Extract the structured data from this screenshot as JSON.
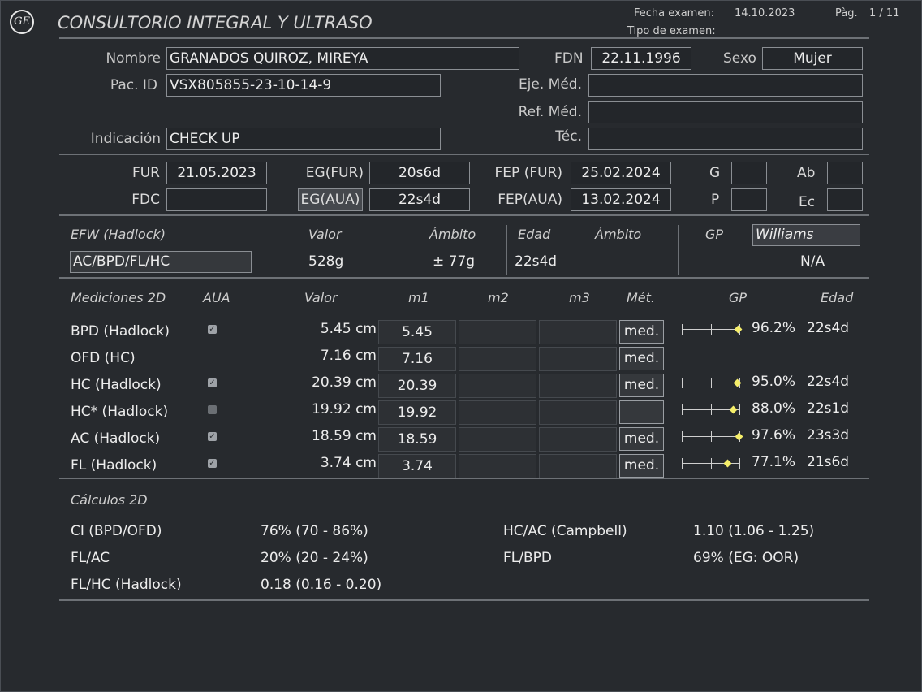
{
  "header": {
    "logo_text": "GE",
    "title": "CONSULTORIO INTEGRAL Y ULTRASO",
    "fecha_label": "Fecha examen:",
    "fecha_value": "14.10.2023",
    "tipo_label": "Tipo de examen:",
    "page_label": "Pàg.",
    "page_value": "1 / 11"
  },
  "patient": {
    "nombre_label": "Nombre",
    "nombre": "GRANADOS QUIROZ, MIREYA",
    "pacid_label": "Pac. ID",
    "pacid": "VSX805855-23-10-14-9",
    "indicacion_label": "Indicación",
    "indicacion": "CHECK UP",
    "fdn_label": "FDN",
    "fdn": "22.11.1996",
    "sexo_label": "Sexo",
    "sexo": "Mujer",
    "eje_label": "Eje. Méd.",
    "eje": "",
    "ref_label": "Ref. Méd.",
    "ref": "",
    "tec_label": "Téc.",
    "tec": ""
  },
  "dates": {
    "fur_label": "FUR",
    "fur": "21.05.2023",
    "fdc_label": "FDC",
    "fdc": "",
    "egfur_label": "EG(FUR)",
    "egfur": "20s6d",
    "egaua_label": "EG(AUA)",
    "egaua": "22s4d",
    "fepfur_label": "FEP (FUR)",
    "fepfur": "25.02.2024",
    "fepaua_label": "FEP(AUA)",
    "fepaua": "13.02.2024",
    "g_label": "G",
    "g": "",
    "p_label": "P",
    "p": "",
    "ab_label": "Ab",
    "ab": "",
    "ec_label": "Ec",
    "ec": ""
  },
  "efw": {
    "title": "EFW (Hadlock)",
    "valor_label": "Valor",
    "ambito_label": "Ámbito",
    "edad_label": "Edad",
    "ambito2_label": "Ámbito",
    "gp_label": "GP",
    "gp_method": "Williams",
    "formula": "AC/BPD/FL/HC",
    "valor": "528g",
    "ambito": "± 77g",
    "edad": "22s4d",
    "gp": "N/A"
  },
  "measurements": {
    "title": "Mediciones 2D",
    "columns": {
      "aua": "AUA",
      "valor": "Valor",
      "m1": "m1",
      "m2": "m2",
      "m3": "m3",
      "met": "Mét.",
      "gp": "GP",
      "edad": "Edad"
    },
    "rows": [
      {
        "name": "BPD (Hadlock)",
        "aua": "checked",
        "valor": "5.45 cm",
        "m1": "5.45",
        "m2": "",
        "m3": "",
        "met": "med.",
        "gp_pct": 96.2,
        "gp": "96.2%",
        "edad": "22s4d"
      },
      {
        "name": "OFD (HC)",
        "aua": "none",
        "valor": "7.16 cm",
        "m1": "7.16",
        "m2": "",
        "m3": "",
        "met": "med.",
        "gp_pct": null,
        "gp": "",
        "edad": ""
      },
      {
        "name": "HC (Hadlock)",
        "aua": "checked",
        "valor": "20.39 cm",
        "m1": "20.39",
        "m2": "",
        "m3": "",
        "met": "med.",
        "gp_pct": 95.0,
        "gp": "95.0%",
        "edad": "22s4d"
      },
      {
        "name": "HC* (Hadlock)",
        "aua": "unchecked",
        "valor": "19.92 cm",
        "m1": "19.92",
        "m2": "",
        "m3": "",
        "met": "",
        "gp_pct": 88.0,
        "gp": "88.0%",
        "edad": "22s1d"
      },
      {
        "name": "AC (Hadlock)",
        "aua": "checked",
        "valor": "18.59 cm",
        "m1": "18.59",
        "m2": "",
        "m3": "",
        "met": "med.",
        "gp_pct": 97.6,
        "gp": "97.6%",
        "edad": "23s3d"
      },
      {
        "name": "FL (Hadlock)",
        "aua": "checked",
        "valor": "3.74 cm",
        "m1": "3.74",
        "m2": "",
        "m3": "",
        "met": "med.",
        "gp_pct": 77.1,
        "gp": "77.1%",
        "edad": "21s6d"
      }
    ]
  },
  "calculations": {
    "title": "Cálculos 2D",
    "items": [
      {
        "label": "CI (BPD/OFD)",
        "value": "76% (70 - 86%)"
      },
      {
        "label": "FL/AC",
        "value": "20% (20 - 24%)"
      },
      {
        "label": "FL/HC (Hadlock)",
        "value": "0.18 (0.16 - 0.20)"
      },
      {
        "label": "HC/AC (Campbell)",
        "value": "1.10 (1.06 - 1.25)"
      },
      {
        "label": "FL/BPD",
        "value": "69% (EG: OOR)"
      }
    ]
  }
}
